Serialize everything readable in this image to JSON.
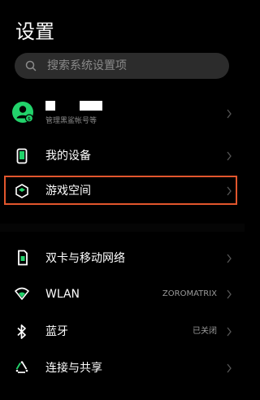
{
  "header": {
    "title": "设置"
  },
  "search": {
    "placeholder": "搜索系统设置项"
  },
  "account": {
    "subtitle": "管理黑鲨帐号等"
  },
  "items": [
    {
      "label": "我的设备",
      "value": "",
      "icon": "device-icon"
    },
    {
      "label": "游戏空间",
      "value": "",
      "icon": "game-space-icon"
    },
    {
      "label": "双卡与移动网络",
      "value": "",
      "icon": "sim-card-icon"
    },
    {
      "label": "WLAN",
      "value": "ZOROMATRIX",
      "icon": "wifi-icon"
    },
    {
      "label": "蓝牙",
      "value": "已关闭",
      "icon": "bluetooth-icon"
    },
    {
      "label": "连接与共享",
      "value": "",
      "icon": "share-icon"
    }
  ],
  "colors": {
    "accent": "#22d36b",
    "highlight": "#e2562d",
    "background": "#000000"
  }
}
